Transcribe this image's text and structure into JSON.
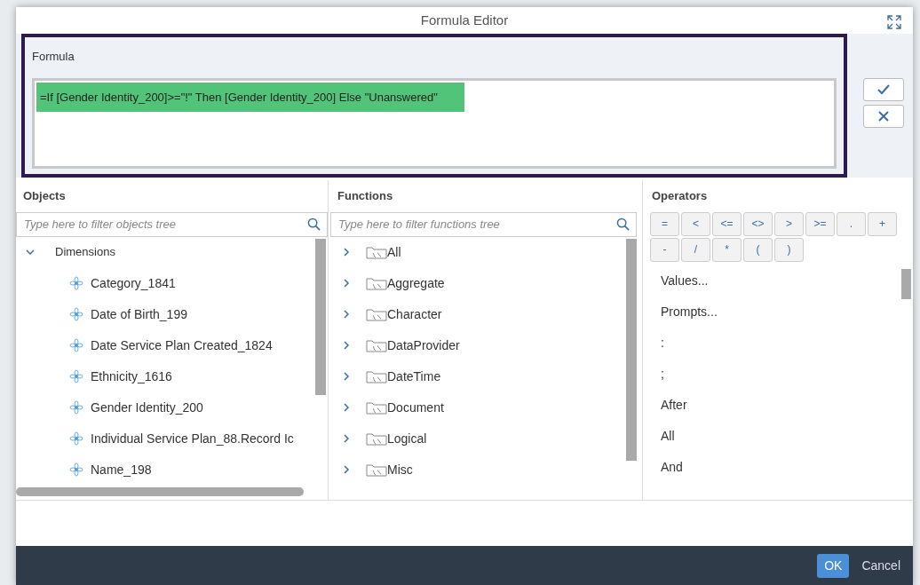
{
  "dialog": {
    "title": "Formula Editor"
  },
  "formula": {
    "label": "Formula",
    "value": "=If [Gender Identity_200]>=\"!\" Then [Gender Identity_200] Else \"Unanswered\"",
    "highlighted": true
  },
  "objects": {
    "title": "Objects",
    "placeholder": "Type here to filter objects tree",
    "tree": [
      {
        "label": "Dimensions",
        "expanded": true,
        "children": [
          {
            "label": "Category_1841"
          },
          {
            "label": "Date of Birth_199"
          },
          {
            "label": "Date Service Plan Created_1824"
          },
          {
            "label": "Ethnicity_1616"
          },
          {
            "label": "Gender Identity_200"
          },
          {
            "label": "Individual Service Plan_88.Record Ic"
          },
          {
            "label": "Name_198"
          }
        ]
      }
    ]
  },
  "functions": {
    "title": "Functions",
    "placeholder": "Type here to filter functions tree",
    "items": [
      {
        "label": "All",
        "expanded": false
      },
      {
        "label": "Aggregate",
        "expanded": false
      },
      {
        "label": "Character",
        "expanded": false
      },
      {
        "label": "DataProvider",
        "expanded": false
      },
      {
        "label": "DateTime",
        "expanded": false
      },
      {
        "label": "Document",
        "expanded": false
      },
      {
        "label": "Logical",
        "expanded": false
      },
      {
        "label": "Misc",
        "expanded": false
      }
    ]
  },
  "operators": {
    "title": "Operators",
    "buttons": [
      "=",
      "<",
      "<=",
      "<>",
      ">",
      ">=",
      ".",
      "+",
      "-",
      "/",
      "*",
      "(",
      ")"
    ],
    "items": [
      "Values...",
      "Prompts...",
      ":",
      ";",
      "After",
      "All",
      "And"
    ]
  },
  "footer": {
    "buttons": [
      {
        "label": "OK",
        "kind": "primary"
      },
      {
        "label": "Cancel",
        "kind": "plain"
      }
    ]
  }
}
